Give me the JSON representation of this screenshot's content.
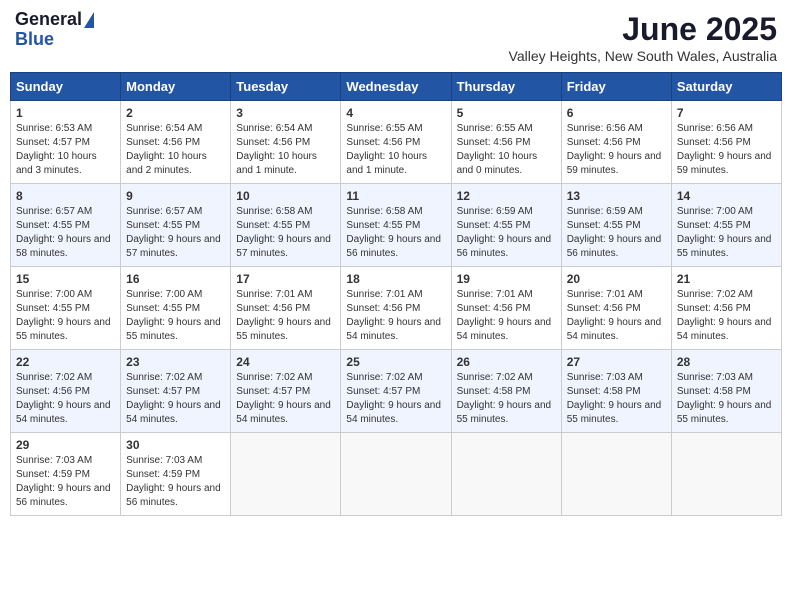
{
  "header": {
    "logo_general": "General",
    "logo_blue": "Blue",
    "month_year": "June 2025",
    "location": "Valley Heights, New South Wales, Australia"
  },
  "days_of_week": [
    "Sunday",
    "Monday",
    "Tuesday",
    "Wednesday",
    "Thursday",
    "Friday",
    "Saturday"
  ],
  "weeks": [
    [
      {
        "day": "1",
        "sunrise": "6:53 AM",
        "sunset": "4:57 PM",
        "daylight": "10 hours and 3 minutes."
      },
      {
        "day": "2",
        "sunrise": "6:54 AM",
        "sunset": "4:56 PM",
        "daylight": "10 hours and 2 minutes."
      },
      {
        "day": "3",
        "sunrise": "6:54 AM",
        "sunset": "4:56 PM",
        "daylight": "10 hours and 1 minute."
      },
      {
        "day": "4",
        "sunrise": "6:55 AM",
        "sunset": "4:56 PM",
        "daylight": "10 hours and 1 minute."
      },
      {
        "day": "5",
        "sunrise": "6:55 AM",
        "sunset": "4:56 PM",
        "daylight": "10 hours and 0 minutes."
      },
      {
        "day": "6",
        "sunrise": "6:56 AM",
        "sunset": "4:56 PM",
        "daylight": "9 hours and 59 minutes."
      },
      {
        "day": "7",
        "sunrise": "6:56 AM",
        "sunset": "4:56 PM",
        "daylight": "9 hours and 59 minutes."
      }
    ],
    [
      {
        "day": "8",
        "sunrise": "6:57 AM",
        "sunset": "4:55 PM",
        "daylight": "9 hours and 58 minutes."
      },
      {
        "day": "9",
        "sunrise": "6:57 AM",
        "sunset": "4:55 PM",
        "daylight": "9 hours and 57 minutes."
      },
      {
        "day": "10",
        "sunrise": "6:58 AM",
        "sunset": "4:55 PM",
        "daylight": "9 hours and 57 minutes."
      },
      {
        "day": "11",
        "sunrise": "6:58 AM",
        "sunset": "4:55 PM",
        "daylight": "9 hours and 56 minutes."
      },
      {
        "day": "12",
        "sunrise": "6:59 AM",
        "sunset": "4:55 PM",
        "daylight": "9 hours and 56 minutes."
      },
      {
        "day": "13",
        "sunrise": "6:59 AM",
        "sunset": "4:55 PM",
        "daylight": "9 hours and 56 minutes."
      },
      {
        "day": "14",
        "sunrise": "7:00 AM",
        "sunset": "4:55 PM",
        "daylight": "9 hours and 55 minutes."
      }
    ],
    [
      {
        "day": "15",
        "sunrise": "7:00 AM",
        "sunset": "4:55 PM",
        "daylight": "9 hours and 55 minutes."
      },
      {
        "day": "16",
        "sunrise": "7:00 AM",
        "sunset": "4:55 PM",
        "daylight": "9 hours and 55 minutes."
      },
      {
        "day": "17",
        "sunrise": "7:01 AM",
        "sunset": "4:56 PM",
        "daylight": "9 hours and 55 minutes."
      },
      {
        "day": "18",
        "sunrise": "7:01 AM",
        "sunset": "4:56 PM",
        "daylight": "9 hours and 54 minutes."
      },
      {
        "day": "19",
        "sunrise": "7:01 AM",
        "sunset": "4:56 PM",
        "daylight": "9 hours and 54 minutes."
      },
      {
        "day": "20",
        "sunrise": "7:01 AM",
        "sunset": "4:56 PM",
        "daylight": "9 hours and 54 minutes."
      },
      {
        "day": "21",
        "sunrise": "7:02 AM",
        "sunset": "4:56 PM",
        "daylight": "9 hours and 54 minutes."
      }
    ],
    [
      {
        "day": "22",
        "sunrise": "7:02 AM",
        "sunset": "4:56 PM",
        "daylight": "9 hours and 54 minutes."
      },
      {
        "day": "23",
        "sunrise": "7:02 AM",
        "sunset": "4:57 PM",
        "daylight": "9 hours and 54 minutes."
      },
      {
        "day": "24",
        "sunrise": "7:02 AM",
        "sunset": "4:57 PM",
        "daylight": "9 hours and 54 minutes."
      },
      {
        "day": "25",
        "sunrise": "7:02 AM",
        "sunset": "4:57 PM",
        "daylight": "9 hours and 54 minutes."
      },
      {
        "day": "26",
        "sunrise": "7:02 AM",
        "sunset": "4:58 PM",
        "daylight": "9 hours and 55 minutes."
      },
      {
        "day": "27",
        "sunrise": "7:03 AM",
        "sunset": "4:58 PM",
        "daylight": "9 hours and 55 minutes."
      },
      {
        "day": "28",
        "sunrise": "7:03 AM",
        "sunset": "4:58 PM",
        "daylight": "9 hours and 55 minutes."
      }
    ],
    [
      {
        "day": "29",
        "sunrise": "7:03 AM",
        "sunset": "4:59 PM",
        "daylight": "9 hours and 56 minutes."
      },
      {
        "day": "30",
        "sunrise": "7:03 AM",
        "sunset": "4:59 PM",
        "daylight": "9 hours and 56 minutes."
      },
      null,
      null,
      null,
      null,
      null
    ]
  ]
}
